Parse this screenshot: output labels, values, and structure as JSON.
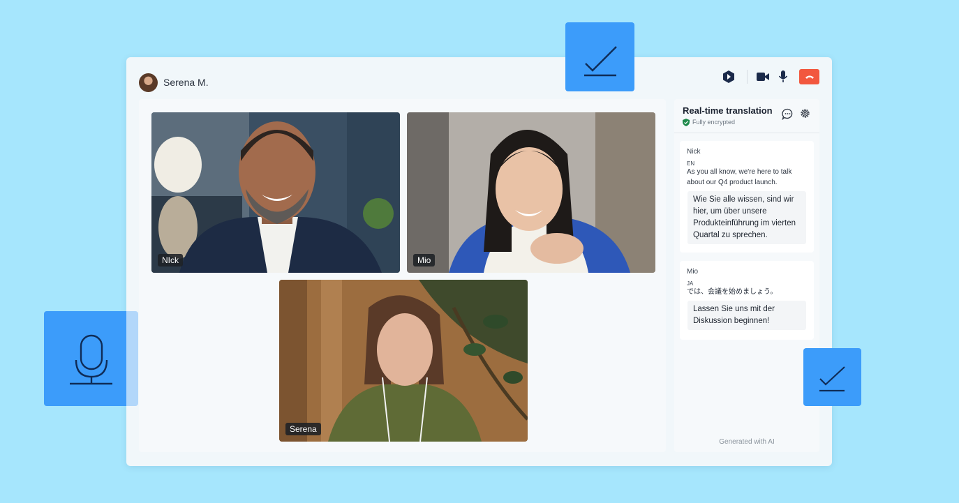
{
  "header": {
    "user_name": "Serena M."
  },
  "participants": [
    {
      "name": "NIck"
    },
    {
      "name": "Mio"
    },
    {
      "name": "Serena"
    }
  ],
  "panel": {
    "title": "Real-time translation",
    "subtitle": "Fully encrypted",
    "messages": [
      {
        "speaker": "Nick",
        "lang": "EN",
        "original": "As you all know, we're here to talk about our Q4 product launch.",
        "translation": "Wie Sie alle wissen, sind wir hier, um über unsere Produkteinführung im vierten Quartal zu sprechen."
      },
      {
        "speaker": "Mio",
        "lang": "JA",
        "original": "では、会議を始めましょう。",
        "translation": "Lassen Sie uns mit der Diskussion beginnen!"
      }
    ],
    "footer": "Generated with AI"
  },
  "colors": {
    "background": "#a6e6fd",
    "accent": "#3c9cfa",
    "hangup": "#f2573e",
    "navy": "#1b2a4a"
  },
  "icons": [
    "logo-icon",
    "video-camera-icon",
    "microphone-icon",
    "hang-up-icon",
    "shield-check-icon",
    "chat-bubble-icon",
    "gear-icon",
    "checkmark-icon"
  ]
}
